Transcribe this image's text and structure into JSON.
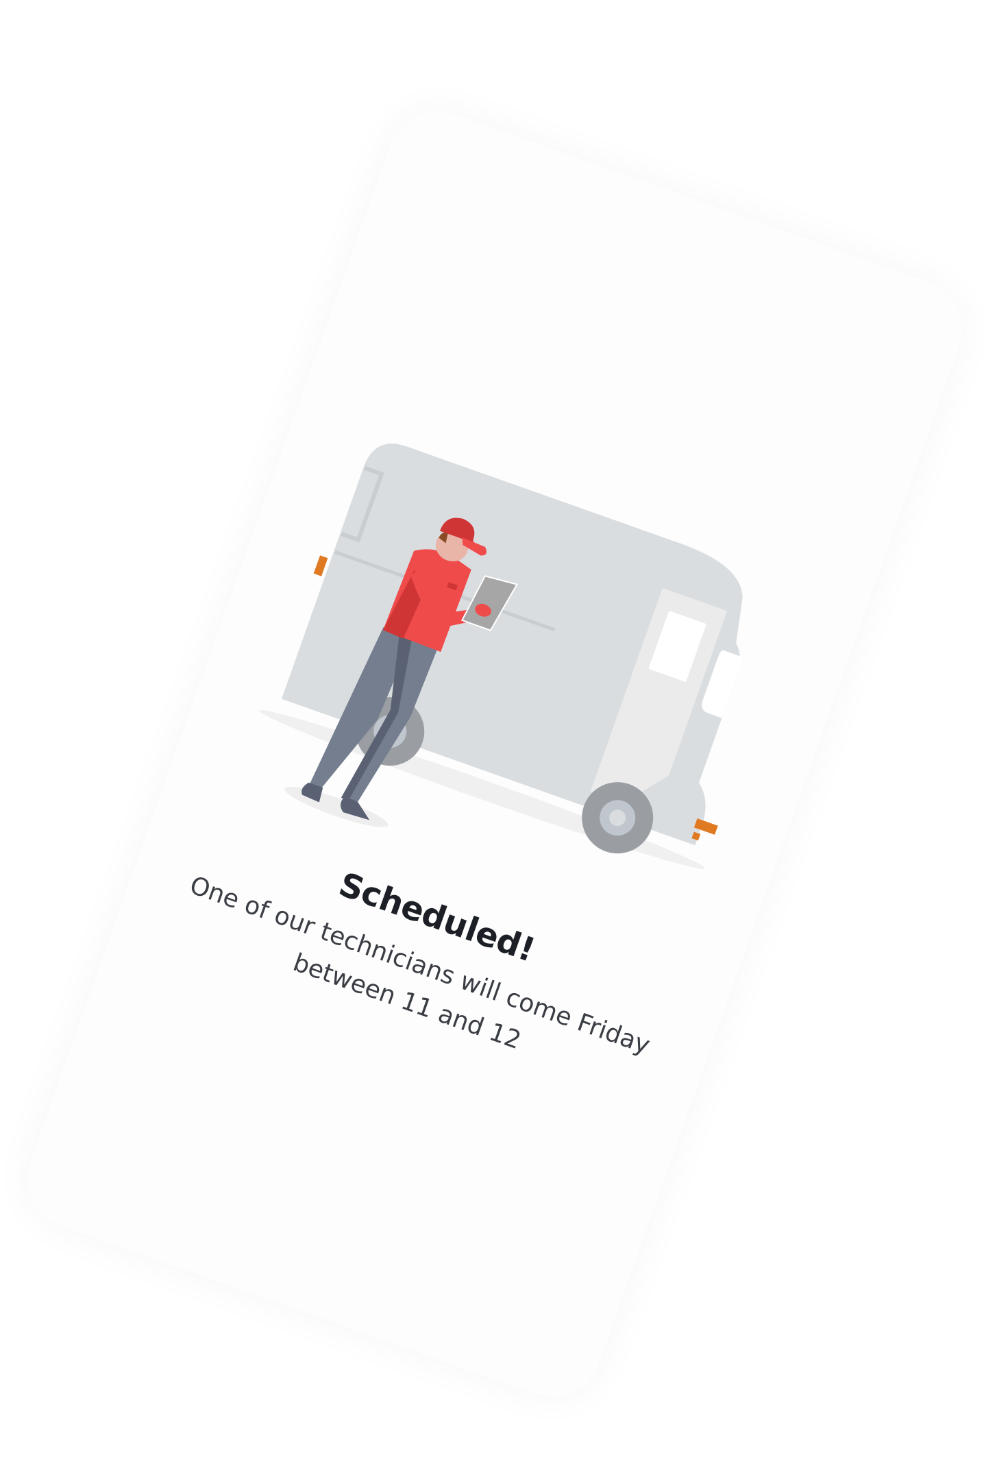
{
  "confirmation": {
    "title": "Scheduled!",
    "message": "One of our technicians will come Friday between 11 and 12"
  },
  "illustration": {
    "name": "delivery-van-technician-illustration",
    "colors": {
      "van_body": "#dadddf",
      "van_door": "#ebebeb",
      "wheel": "#9a9ea3",
      "hub": "#c0c6cd",
      "accent_orange": "#e07a22",
      "shirt": "#f04b4b",
      "shirt_shadow": "#d03535",
      "pants": "#747e8f",
      "pants_shadow": "#5a6172",
      "tablet": "#a6a6a6",
      "skin": "#e9b5a8",
      "hair": "#8a4b27",
      "shadow": "#f0f0f0"
    }
  }
}
